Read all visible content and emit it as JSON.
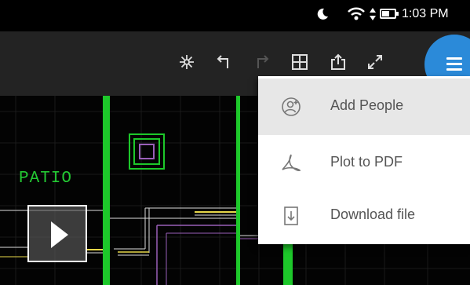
{
  "status_bar": {
    "time": "1:03 PM",
    "icons": [
      "moon-icon",
      "wifi-icon",
      "data-transfer-icon",
      "battery-icon"
    ]
  },
  "toolbar": {
    "icons": [
      "snap-icon",
      "undo-icon",
      "redo-icon",
      "layout-icon",
      "share-icon",
      "fullscreen-icon",
      "menu-icon"
    ],
    "menu_fab_color": "#2b8ad9"
  },
  "drawing": {
    "room_label": "PATIO",
    "line_colors": {
      "wall": "#1dc82a",
      "yellow": "#e8d84a",
      "purple": "#9a5fb8",
      "white": "#dcdcdc",
      "grid": "#262626"
    }
  },
  "video_overlay": {
    "icon": "play-icon"
  },
  "dropdown_menu": {
    "items": [
      {
        "label": "Add People",
        "icon": "add-people-icon",
        "selected": true
      },
      {
        "label": "Plot to PDF",
        "icon": "pdf-icon",
        "selected": false
      },
      {
        "label": "Download file",
        "icon": "download-file-icon",
        "selected": false
      }
    ]
  }
}
